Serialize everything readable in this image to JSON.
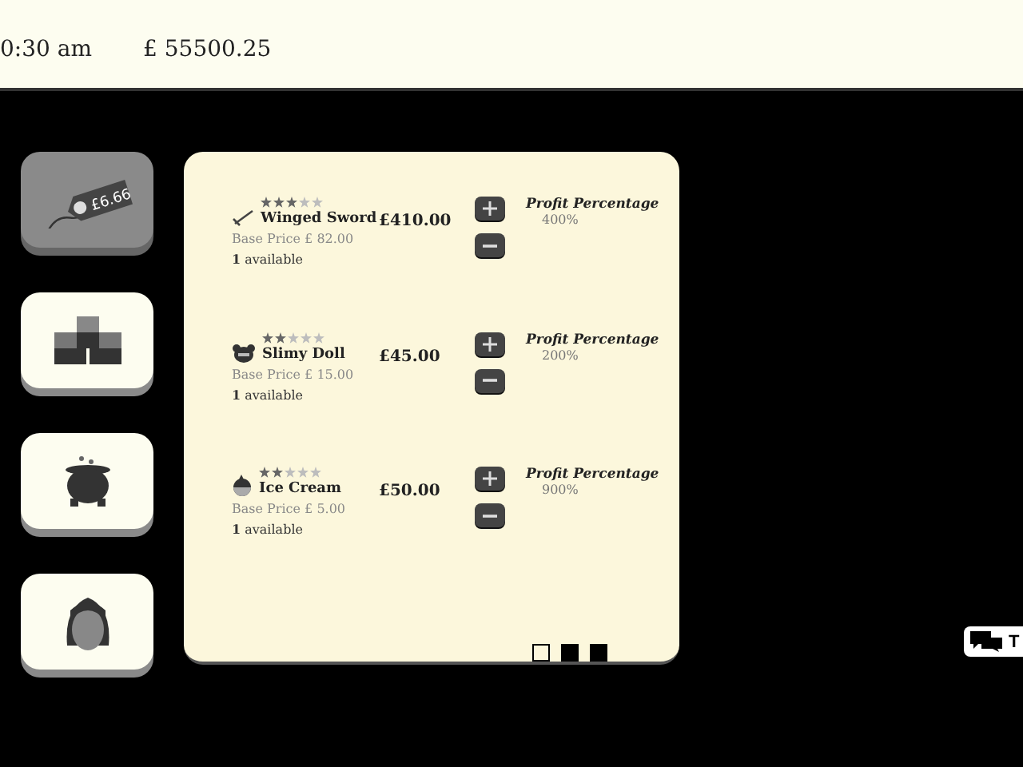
{
  "top_bar": {
    "time": "0:30 am",
    "money": "£ 55500.25"
  },
  "sidebar": {
    "items": [
      {
        "kind": "price-tag",
        "tag_text": "£6.66",
        "selected": true
      },
      {
        "kind": "blocks",
        "selected": false
      },
      {
        "kind": "cauldron",
        "selected": false
      },
      {
        "kind": "person",
        "selected": false
      }
    ]
  },
  "products": [
    {
      "kind": "sword",
      "stars": 3,
      "name": "Winged Sword",
      "price": "£410.00",
      "base_price": "Base Price £ 82.00",
      "available": "**1** available",
      "profit_label": "Profit Percentage",
      "profit": "400%"
    },
    {
      "kind": "bear",
      "stars": 2,
      "name": "Slimy Doll",
      "price": "£45.00",
      "base_price": "Base Price £ 15.00",
      "available": "**1** available",
      "profit_label": "Profit Percentage",
      "profit": "200%"
    },
    {
      "kind": "icecream",
      "stars": 2,
      "name": "Ice Cream",
      "price": "£50.00",
      "base_price": "Base Price £ 5.00",
      "available": "**1** available",
      "profit_label": "Profit Percentage",
      "profit": "900%"
    }
  ],
  "pages": [
    {
      "selected": true
    },
    {
      "selected": false
    },
    {
      "selected": false
    }
  ],
  "chat_button": {
    "label": "T"
  }
}
